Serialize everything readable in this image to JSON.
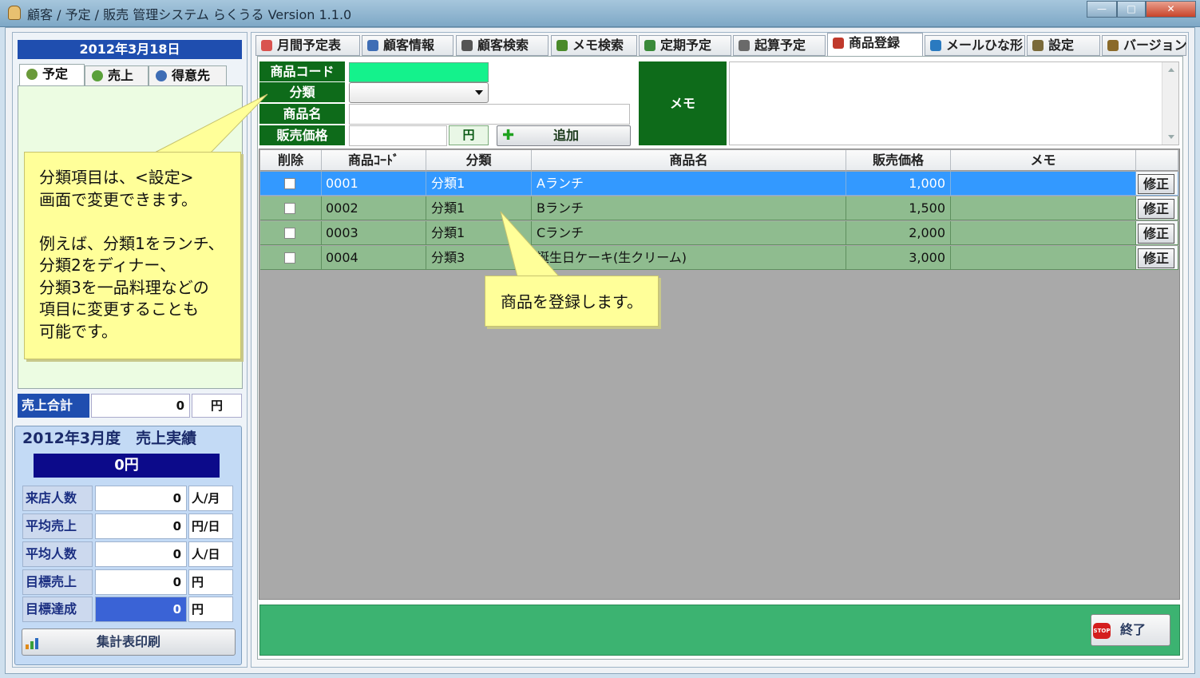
{
  "window": {
    "title": "顧客 / 予定 / 販売 管理システム らくうる  Version 1.1.0",
    "min_glyph": "—",
    "max_glyph": "□",
    "close_glyph": "✕"
  },
  "sidebar": {
    "date": "2012年3月18日",
    "tabs": [
      {
        "label": "予定",
        "icon": "clock-icon"
      },
      {
        "label": "売上",
        "icon": "money-bag-icon"
      },
      {
        "label": "得意先",
        "icon": "people-icon"
      }
    ],
    "sales_total": {
      "label": "売上合計",
      "value": "0",
      "unit": "円"
    },
    "monthly": {
      "title": "2012年3月度　売上実績",
      "total": "0円",
      "stats": [
        {
          "label": "来店人数",
          "value": "0",
          "unit": "人/月"
        },
        {
          "label": "平均売上",
          "value": "0",
          "unit": "円/日"
        },
        {
          "label": "平均人数",
          "value": "0",
          "unit": "人/日"
        },
        {
          "label": "目標売上",
          "value": "0",
          "unit": "円"
        },
        {
          "label": "目標達成",
          "value": "0",
          "unit": "円"
        }
      ]
    },
    "print_label": "集計表印刷"
  },
  "tabs": [
    {
      "label": "月間予定表",
      "icon": "calendar-icon",
      "color": "#d9534f"
    },
    {
      "label": "顧客情報",
      "icon": "people-icon",
      "color": "#3e6db5"
    },
    {
      "label": "顧客検索",
      "icon": "search-icon",
      "color": "#555555"
    },
    {
      "label": "メモ検索",
      "icon": "person-icon",
      "color": "#4a8a2a"
    },
    {
      "label": "定期予定",
      "icon": "clock-icon",
      "color": "#3a8a3a"
    },
    {
      "label": "起算予定",
      "icon": "alarm-icon",
      "color": "#6a6a6a"
    },
    {
      "label": "商品登録",
      "icon": "gift-icon",
      "color": "#c0392b"
    },
    {
      "label": "メールひな形",
      "icon": "mail-icon",
      "color": "#2a7ac0"
    },
    {
      "label": "設定",
      "icon": "tools-icon",
      "color": "#7a6a3a"
    },
    {
      "label": "バージョン",
      "icon": "info-icon",
      "color": "#8a6a2a"
    }
  ],
  "form": {
    "code_label": "商品コード",
    "category_label": "分類",
    "name_label": "商品名",
    "price_label": "販売価格",
    "code_value": "",
    "category_value": "",
    "name_value": "",
    "price_value": "",
    "yen": "円",
    "add_label": "追加",
    "memo_label": "メモ",
    "memo_value": ""
  },
  "table": {
    "columns": [
      "削除",
      "商品ｺｰﾄﾞ",
      "分類",
      "商品名",
      "販売価格",
      "メモ"
    ],
    "edit_label": "修正",
    "rows": [
      {
        "code": "0001",
        "category": "分類1",
        "name": "Aランチ",
        "price": "1,000",
        "memo": ""
      },
      {
        "code": "0002",
        "category": "分類1",
        "name": "Bランチ",
        "price": "1,500",
        "memo": ""
      },
      {
        "code": "0003",
        "category": "分類1",
        "name": "Cランチ",
        "price": "2,000",
        "memo": ""
      },
      {
        "code": "0004",
        "category": "分類3",
        "name": "誕生日ケーキ(生クリーム)",
        "price": "3,000",
        "memo": ""
      }
    ]
  },
  "footer": {
    "end_label": "終了",
    "stop_text": "STOP"
  },
  "callouts": {
    "category_note": "分類項目は、<設定>\n画面で変更できます。\n\n例えば、分類1をランチ、\n分類2をディナー、\n分類3を一品料理などの\n項目に変更することも\n可能です。",
    "register_note": "商品を登録します。"
  },
  "colors": {
    "accent_blue": "#1f4eaf",
    "form_green": "#0e6b1a",
    "code_field": "#14f28c",
    "row_green": "#8fbc8f",
    "row_selected": "#3399ff",
    "footer_green": "#3cb371",
    "callout_yellow": "#ffff99"
  }
}
